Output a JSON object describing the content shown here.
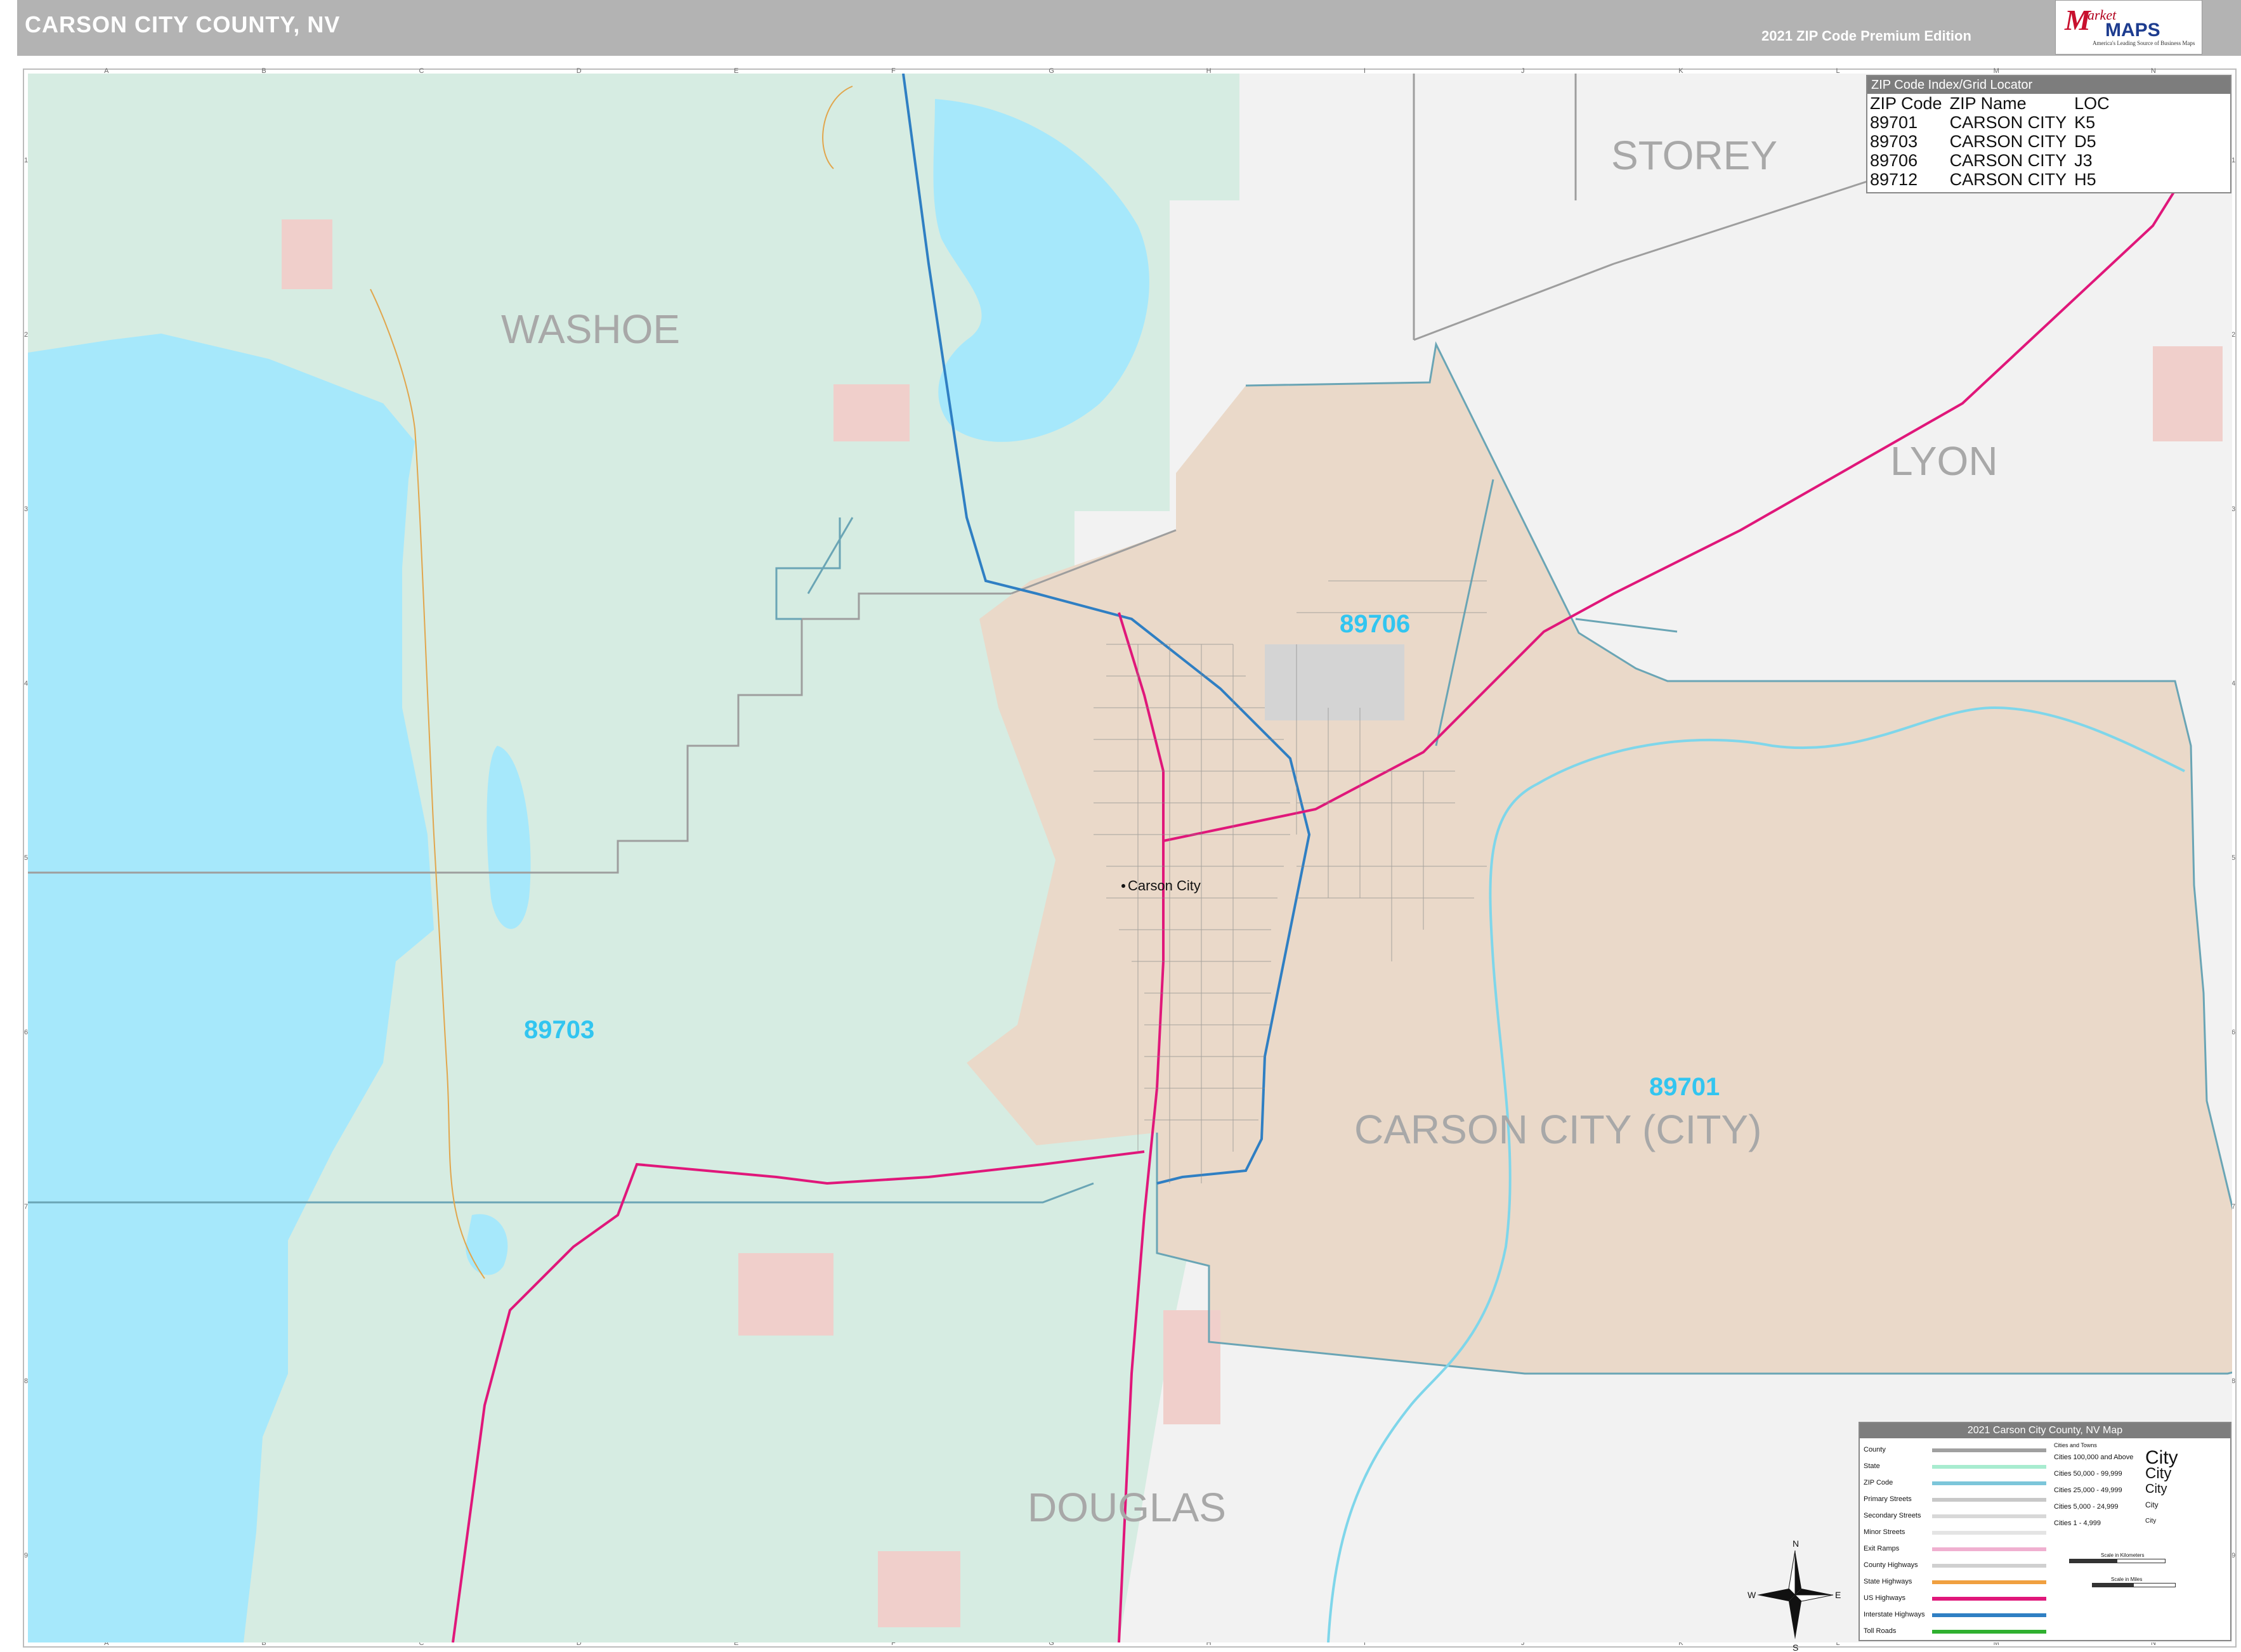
{
  "header": {
    "title": "CARSON CITY COUNTY, NV",
    "edition": "2021 ZIP Code Premium Edition"
  },
  "logo": {
    "m": "M",
    "market": "arket",
    "maps": "MAPS",
    "tagline": "America's Leading Source of Business Maps"
  },
  "grid": {
    "letters": [
      "A",
      "B",
      "C",
      "D",
      "E",
      "F",
      "G",
      "H",
      "I",
      "J",
      "K",
      "L",
      "M",
      "N"
    ],
    "numbers": [
      "1",
      "2",
      "3",
      "4",
      "5",
      "6",
      "7",
      "8",
      "9"
    ]
  },
  "map": {
    "counties": {
      "washoe": "WASHOE",
      "storey": "STOREY",
      "lyon": "LYON",
      "douglas": "DOUGLAS",
      "carson": "CARSON CITY (CITY)"
    },
    "zips": {
      "z89706": "89706",
      "z89703": "89703",
      "z89701": "89701"
    },
    "city_label": "Carson City",
    "colors": {
      "lake": "#a6e8fb",
      "washoe": "#d6ece2",
      "carson": "#ead9c9",
      "outside": "#f2f2f2",
      "park": "#f0cfcb",
      "zip_label": "#32c5f0",
      "county_label": "#a8a8a8",
      "interstate": "#2f7fc3",
      "us_highway": "#e0177a",
      "county_boundary": "#9e9e9e",
      "zip_boundary": "#6aa5b5"
    }
  },
  "zip_index": {
    "title": "ZIP Code Index/Grid Locator",
    "headers": [
      "ZIP Code",
      "ZIP Name",
      "LOC"
    ],
    "rows": [
      [
        "89701",
        "CARSON CITY",
        "K5"
      ],
      [
        "89703",
        "CARSON CITY",
        "D5"
      ],
      [
        "89706",
        "CARSON CITY",
        "J3"
      ],
      [
        "89712",
        "CARSON CITY",
        "H5"
      ]
    ]
  },
  "legend": {
    "title": "2021 Carson City County, NV Map",
    "cities_heading": "Cities and Towns",
    "rows": [
      {
        "label": "County",
        "color": "#a0a0a0"
      },
      {
        "label": "State",
        "color": "#a8ecd0"
      },
      {
        "label": "ZIP Code",
        "color": "#7cc6da"
      },
      {
        "label": "Primary Streets",
        "color": "#c8c8c8"
      },
      {
        "label": "Secondary Streets",
        "color": "#d8d8d8"
      },
      {
        "label": "Minor Streets",
        "color": "#e4e4e4"
      },
      {
        "label": "Exit Ramps",
        "color": "#f0b0d0"
      },
      {
        "label": "County Highways",
        "color": "#d0d0d0"
      },
      {
        "label": "State Highways",
        "color": "#f0a040"
      },
      {
        "label": "US Highways",
        "color": "#e0177a"
      },
      {
        "label": "Interstate Highways",
        "color": "#2f7fc3"
      },
      {
        "label": "Toll Roads",
        "color": "#30b030"
      }
    ],
    "city_classes": [
      {
        "label": "Cities 100,000 and Above",
        "sample": "City"
      },
      {
        "label": "Cities 50,000 - 99,999",
        "sample": "City"
      },
      {
        "label": "Cities 25,000 - 49,999",
        "sample": "City"
      },
      {
        "label": "Cities 5,000 - 24,999",
        "sample": "City"
      },
      {
        "label": "Cities 1 - 4,999",
        "sample": "City"
      }
    ],
    "scale_km": "Scale in Kilometers",
    "scale_mi": "Scale in Miles",
    "compass": {
      "n": "N",
      "s": "S",
      "e": "E",
      "w": "W"
    }
  }
}
